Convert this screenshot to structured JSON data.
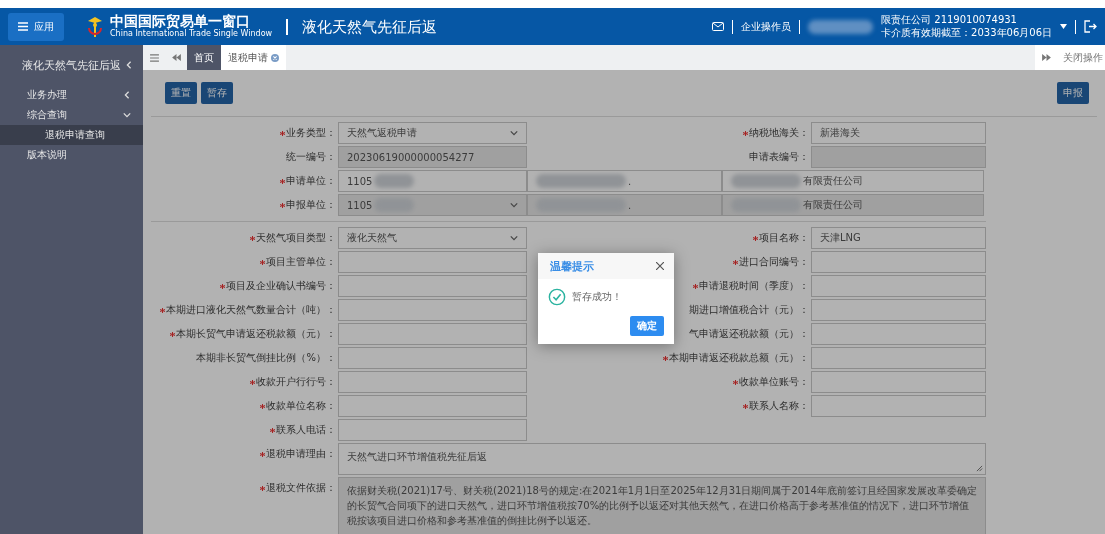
{
  "header": {
    "menu_button": "应用",
    "site_title": "中国国际贸易单一窗口",
    "site_subtitle": "China International Trade Single Window",
    "module_title": "液化天然气先征后返",
    "user_role": "企业操作员",
    "company": "限责任公司 2119010074931",
    "card_expiry": "卡介质有效期截至：2033年06月06日"
  },
  "tabs": [
    {
      "label": "首页",
      "kind": "home",
      "selected": false
    },
    {
      "label": "退税申请",
      "kind": "page",
      "selected": true
    }
  ],
  "close_ops": "关闭操作",
  "sidebar": {
    "title": "液化天然气先征后返",
    "items": [
      {
        "label": "业务办理",
        "expanded": false,
        "selected": false
      },
      {
        "label": "综合查询",
        "expanded": true,
        "selected": false,
        "children": [
          {
            "label": "退税申请查询",
            "selected": true
          }
        ]
      },
      {
        "label": "版本说明",
        "selected": false
      }
    ]
  },
  "toolbar": {
    "left_buttons": [
      "重置",
      "暂存"
    ],
    "right_buttons": [
      "申报"
    ]
  },
  "rows": [
    {
      "fields": [
        {
          "label": "业务类型：",
          "required": true,
          "kind": "select",
          "value": "天然气返税申请",
          "disabled": false
        },
        {
          "label": "纳税地海关：",
          "required": true,
          "kind": "input",
          "value": "新港海关",
          "disabled": false
        }
      ]
    },
    {
      "fields": [
        {
          "label": "统一编号：",
          "required": false,
          "kind": "input",
          "value": "20230619000000054277",
          "disabled": true
        },
        {
          "label": "申请表编号：",
          "required": false,
          "kind": "input",
          "disabled": true
        }
      ]
    },
    {
      "fields": [
        {
          "label": "申请单位：",
          "required": true,
          "kind": "party",
          "disabled": false,
          "parts": [
            {
              "value": "1105"
            },
            {
              "value": "."
            },
            {
              "value": "有限责任公司"
            }
          ]
        }
      ]
    },
    {
      "divider_after": true,
      "fields": [
        {
          "label": "申报单位：",
          "required": true,
          "kind": "party_select",
          "disabled": true,
          "parts": [
            {
              "value": "1105"
            },
            {
              "value": "."
            },
            {
              "value": "有限责任公司"
            }
          ]
        }
      ]
    },
    {
      "fields": [
        {
          "label": "天然气项目类型：",
          "required": true,
          "kind": "select",
          "value": "液化天然气",
          "disabled": false
        },
        {
          "label": "项目名称：",
          "required": true,
          "kind": "input",
          "value": "天津LNG",
          "disabled": false
        }
      ]
    },
    {
      "fields": [
        {
          "label": "项目主管单位：",
          "required": true,
          "kind": "input",
          "disabled": false
        },
        {
          "label": "进口合同编号：",
          "required": true,
          "kind": "input",
          "disabled": false
        }
      ]
    },
    {
      "fields": [
        {
          "label": "项目及企业确认书编号：",
          "required": true,
          "kind": "input",
          "disabled": false
        },
        {
          "label": "申请退税时间（季度）：",
          "required": true,
          "kind": "input",
          "disabled": false
        }
      ]
    },
    {
      "fields": [
        {
          "label": "本期进口液化天然气数量合计（吨）：",
          "required": true,
          "kind": "input",
          "disabled": false
        },
        {
          "label": "期进口增值税合计（元）：",
          "required": false,
          "kind": "input",
          "disabled": false
        }
      ]
    },
    {
      "fields": [
        {
          "label": "本期长贸气申请返还税款额（元）：",
          "required": true,
          "kind": "input",
          "disabled": false
        },
        {
          "label": "气申请返还税款额（元）：",
          "required": false,
          "kind": "input",
          "disabled": false
        }
      ]
    },
    {
      "fields": [
        {
          "label": "本期非长贸气倒挂比例（%）：",
          "required": false,
          "kind": "input",
          "disabled": false
        },
        {
          "label": "本期申请返还税款总额（元）：",
          "required": true,
          "kind": "input",
          "disabled": false
        }
      ]
    },
    {
      "fields": [
        {
          "label": "收款开户行行号：",
          "required": true,
          "kind": "input",
          "disabled": false
        },
        {
          "label": "收款单位账号：",
          "required": true,
          "kind": "input",
          "disabled": false
        }
      ]
    },
    {
      "fields": [
        {
          "label": "收款单位名称：",
          "required": true,
          "kind": "input",
          "disabled": false
        },
        {
          "label": "联系人名称：",
          "required": true,
          "kind": "input",
          "disabled": false
        }
      ]
    },
    {
      "fields": [
        {
          "label": "联系人电话：",
          "required": true,
          "kind": "input",
          "disabled": false
        }
      ]
    },
    {
      "fields": [
        {
          "label": "退税申请理由：",
          "required": true,
          "kind": "textarea",
          "value": "天然气进口环节增值税先征后返",
          "disabled": false
        }
      ]
    },
    {
      "fields": [
        {
          "label": "退税文件依据：",
          "required": true,
          "kind": "document",
          "value": "依据财关税(2021)17号、财关税(2021)18号的规定:在2021年1月1日至2025年12月31日期间属于2014年底前签订且经国家发展改革委确定的长贸气合同项下的进口天然气，进口环节增值税按70%的比例予以返还对其他天然气，在进口价格高于参考基准值的情况下，进口环节增值税按该项目进口价格和参考基准值的倒挂比例予以返还。",
          "disabled": true
        }
      ]
    }
  ],
  "modal": {
    "title": "温馨提示",
    "message": "暂存成功！",
    "button": "确定"
  }
}
